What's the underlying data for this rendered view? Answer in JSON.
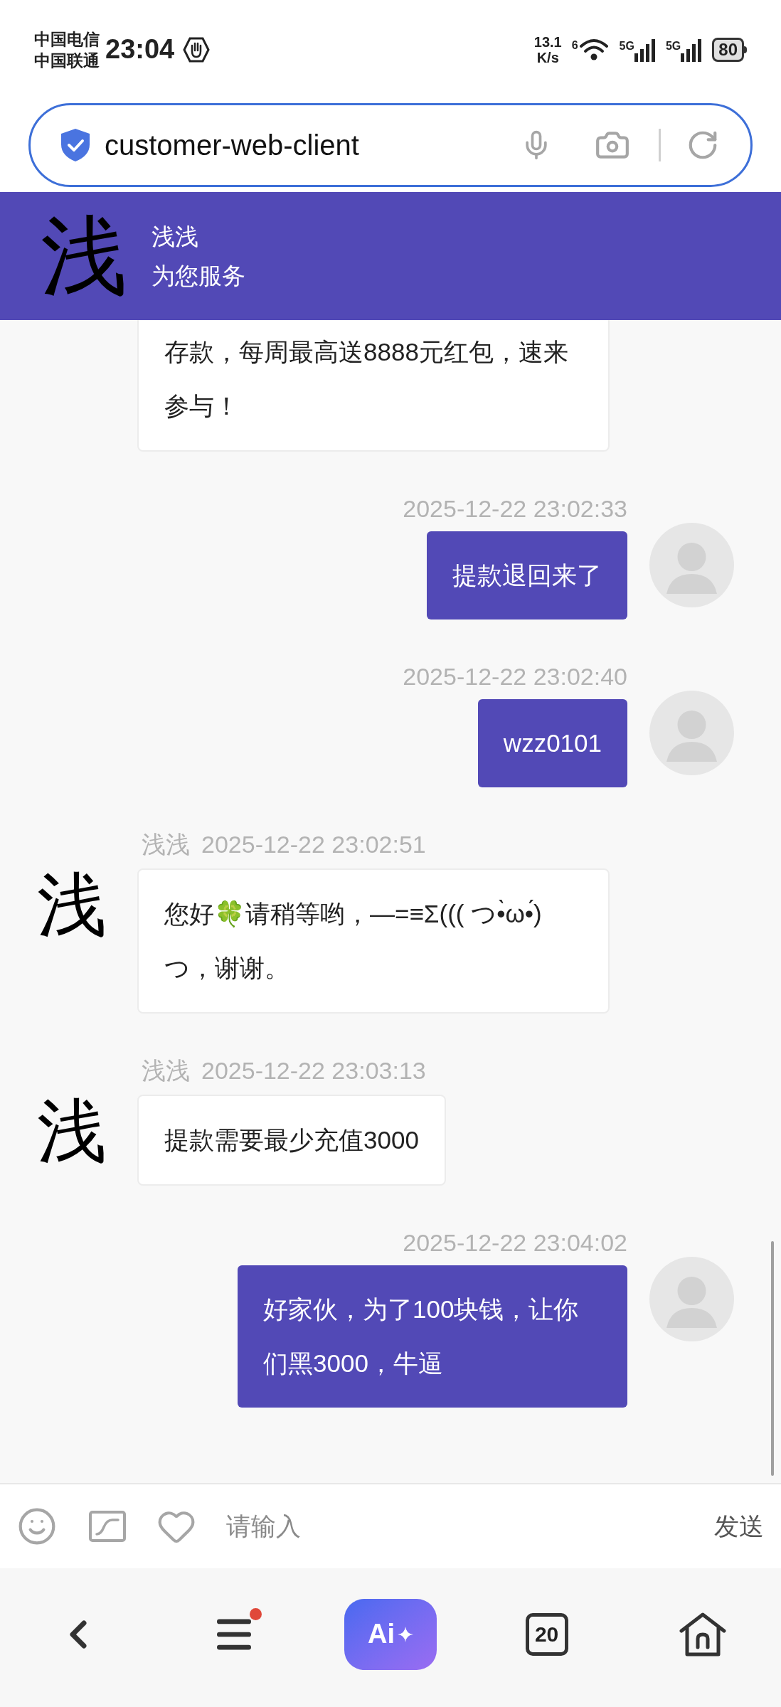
{
  "status_bar": {
    "carriers": [
      "中国电信",
      "中国联通"
    ],
    "time": "23:04",
    "net_speed": [
      "13.1",
      "K/s"
    ],
    "wifi_label": "6",
    "signals": [
      {
        "label": "5G"
      },
      {
        "label": "5G"
      }
    ],
    "battery": "80"
  },
  "address_bar": {
    "url": "customer-web-client"
  },
  "chat_header": {
    "avatar_char": "浅",
    "name": "浅浅",
    "subtitle": "为您服务"
  },
  "messages": [
    {
      "kind": "agent",
      "text": "存款，每周最高送8888元红包，速来参与！"
    },
    {
      "kind": "user",
      "time": "2025-12-22 23:02:33",
      "text": "提款退回来了"
    },
    {
      "kind": "user",
      "time": "2025-12-22 23:02:40",
      "text": "wzz0101"
    },
    {
      "kind": "agent",
      "avatar_char": "浅",
      "name": "浅浅",
      "time": "2025-12-22 23:02:51",
      "text": "您好🍀请稍等哟，—=≡Σ((( つ•̀ω•́)つ，谢谢。"
    },
    {
      "kind": "agent",
      "avatar_char": "浅",
      "name": "浅浅",
      "time": "2025-12-22 23:03:13",
      "text": "提款需要最少充值3000"
    },
    {
      "kind": "user",
      "time": "2025-12-22 23:04:02",
      "text": "好家伙，为了100块钱，让你们黑3000，牛逼"
    }
  ],
  "composer": {
    "placeholder": "请输入",
    "send": "发送"
  },
  "nav_bar": {
    "ai_label": "Ai",
    "tabs_count": "20",
    "menu_badge": true
  }
}
